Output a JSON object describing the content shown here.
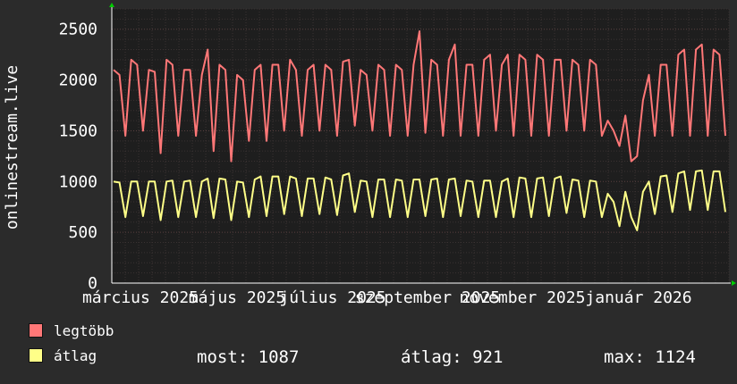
{
  "chart_data": {
    "type": "line",
    "ylabel": "onlinestream.live",
    "ylim": [
      0,
      2700
    ],
    "yticks": [
      0,
      500,
      1000,
      1500,
      2000,
      2500
    ],
    "xlabels": [
      "március 2025",
      "május 2025",
      "július 2025",
      "szeptember 2025",
      "november 2025",
      "január 2026"
    ],
    "grid": true,
    "series": [
      {
        "name": "legtöbb",
        "color": "#ff7777",
        "weekly_high": 2120,
        "weekly_low": 1450,
        "values": [
          2100,
          2050,
          1450,
          2200,
          2150,
          1500,
          2100,
          2080,
          1280,
          2200,
          2150,
          1450,
          2100,
          2100,
          1450,
          2050,
          2300,
          1300,
          2150,
          2100,
          1200,
          2050,
          2000,
          1400,
          2100,
          2150,
          1400,
          2150,
          2150,
          1500,
          2200,
          2100,
          1450,
          2100,
          2150,
          1500,
          2150,
          2100,
          1450,
          2180,
          2200,
          1550,
          2100,
          2050,
          1500,
          2150,
          2100,
          1450,
          2150,
          2100,
          1450,
          2150,
          2480,
          1480,
          2200,
          2150,
          1450,
          2200,
          2350,
          1450,
          2150,
          2150,
          1450,
          2200,
          2250,
          1500,
          2150,
          2250,
          1450,
          2250,
          2200,
          1450,
          2250,
          2200,
          1450,
          2200,
          2200,
          1500,
          2200,
          2150,
          1500,
          2200,
          2150,
          1450,
          1600,
          1500,
          1350,
          1650,
          1200,
          1250,
          1800,
          2050,
          1450,
          2150,
          2150,
          1450,
          2250,
          2300,
          1450,
          2300,
          2350,
          1450,
          2300,
          2250,
          1450
        ]
      },
      {
        "name": "átlag",
        "color": "#ffff88",
        "weekly_high": 1010,
        "weekly_low": 650,
        "values": [
          1000,
          990,
          650,
          1000,
          1000,
          660,
          1000,
          1000,
          620,
          1000,
          1010,
          650,
          1000,
          1010,
          650,
          1000,
          1030,
          640,
          1030,
          1020,
          620,
          1000,
          990,
          650,
          1020,
          1050,
          660,
          1050,
          1050,
          680,
          1050,
          1030,
          660,
          1030,
          1030,
          680,
          1040,
          1020,
          670,
          1060,
          1080,
          700,
          1010,
          1000,
          650,
          1020,
          1020,
          650,
          1020,
          1010,
          650,
          1020,
          1020,
          660,
          1020,
          1030,
          650,
          1020,
          1030,
          660,
          1010,
          1000,
          650,
          1010,
          1010,
          650,
          1000,
          1030,
          650,
          1040,
          1030,
          650,
          1030,
          1040,
          660,
          1030,
          1050,
          690,
          1020,
          1010,
          650,
          1010,
          1000,
          650,
          880,
          800,
          560,
          900,
          650,
          520,
          900,
          1000,
          680,
          1050,
          1060,
          700,
          1080,
          1100,
          720,
          1100,
          1110,
          720,
          1100,
          1100,
          700
        ]
      }
    ]
  },
  "legend": [
    {
      "label": "legtöbb",
      "color": "#ff7777"
    },
    {
      "label": "átlag",
      "color": "#ffff88"
    }
  ],
  "stats": {
    "most": "most: 1087",
    "atlag": "átlag: 921",
    "max": "max: 1124"
  }
}
